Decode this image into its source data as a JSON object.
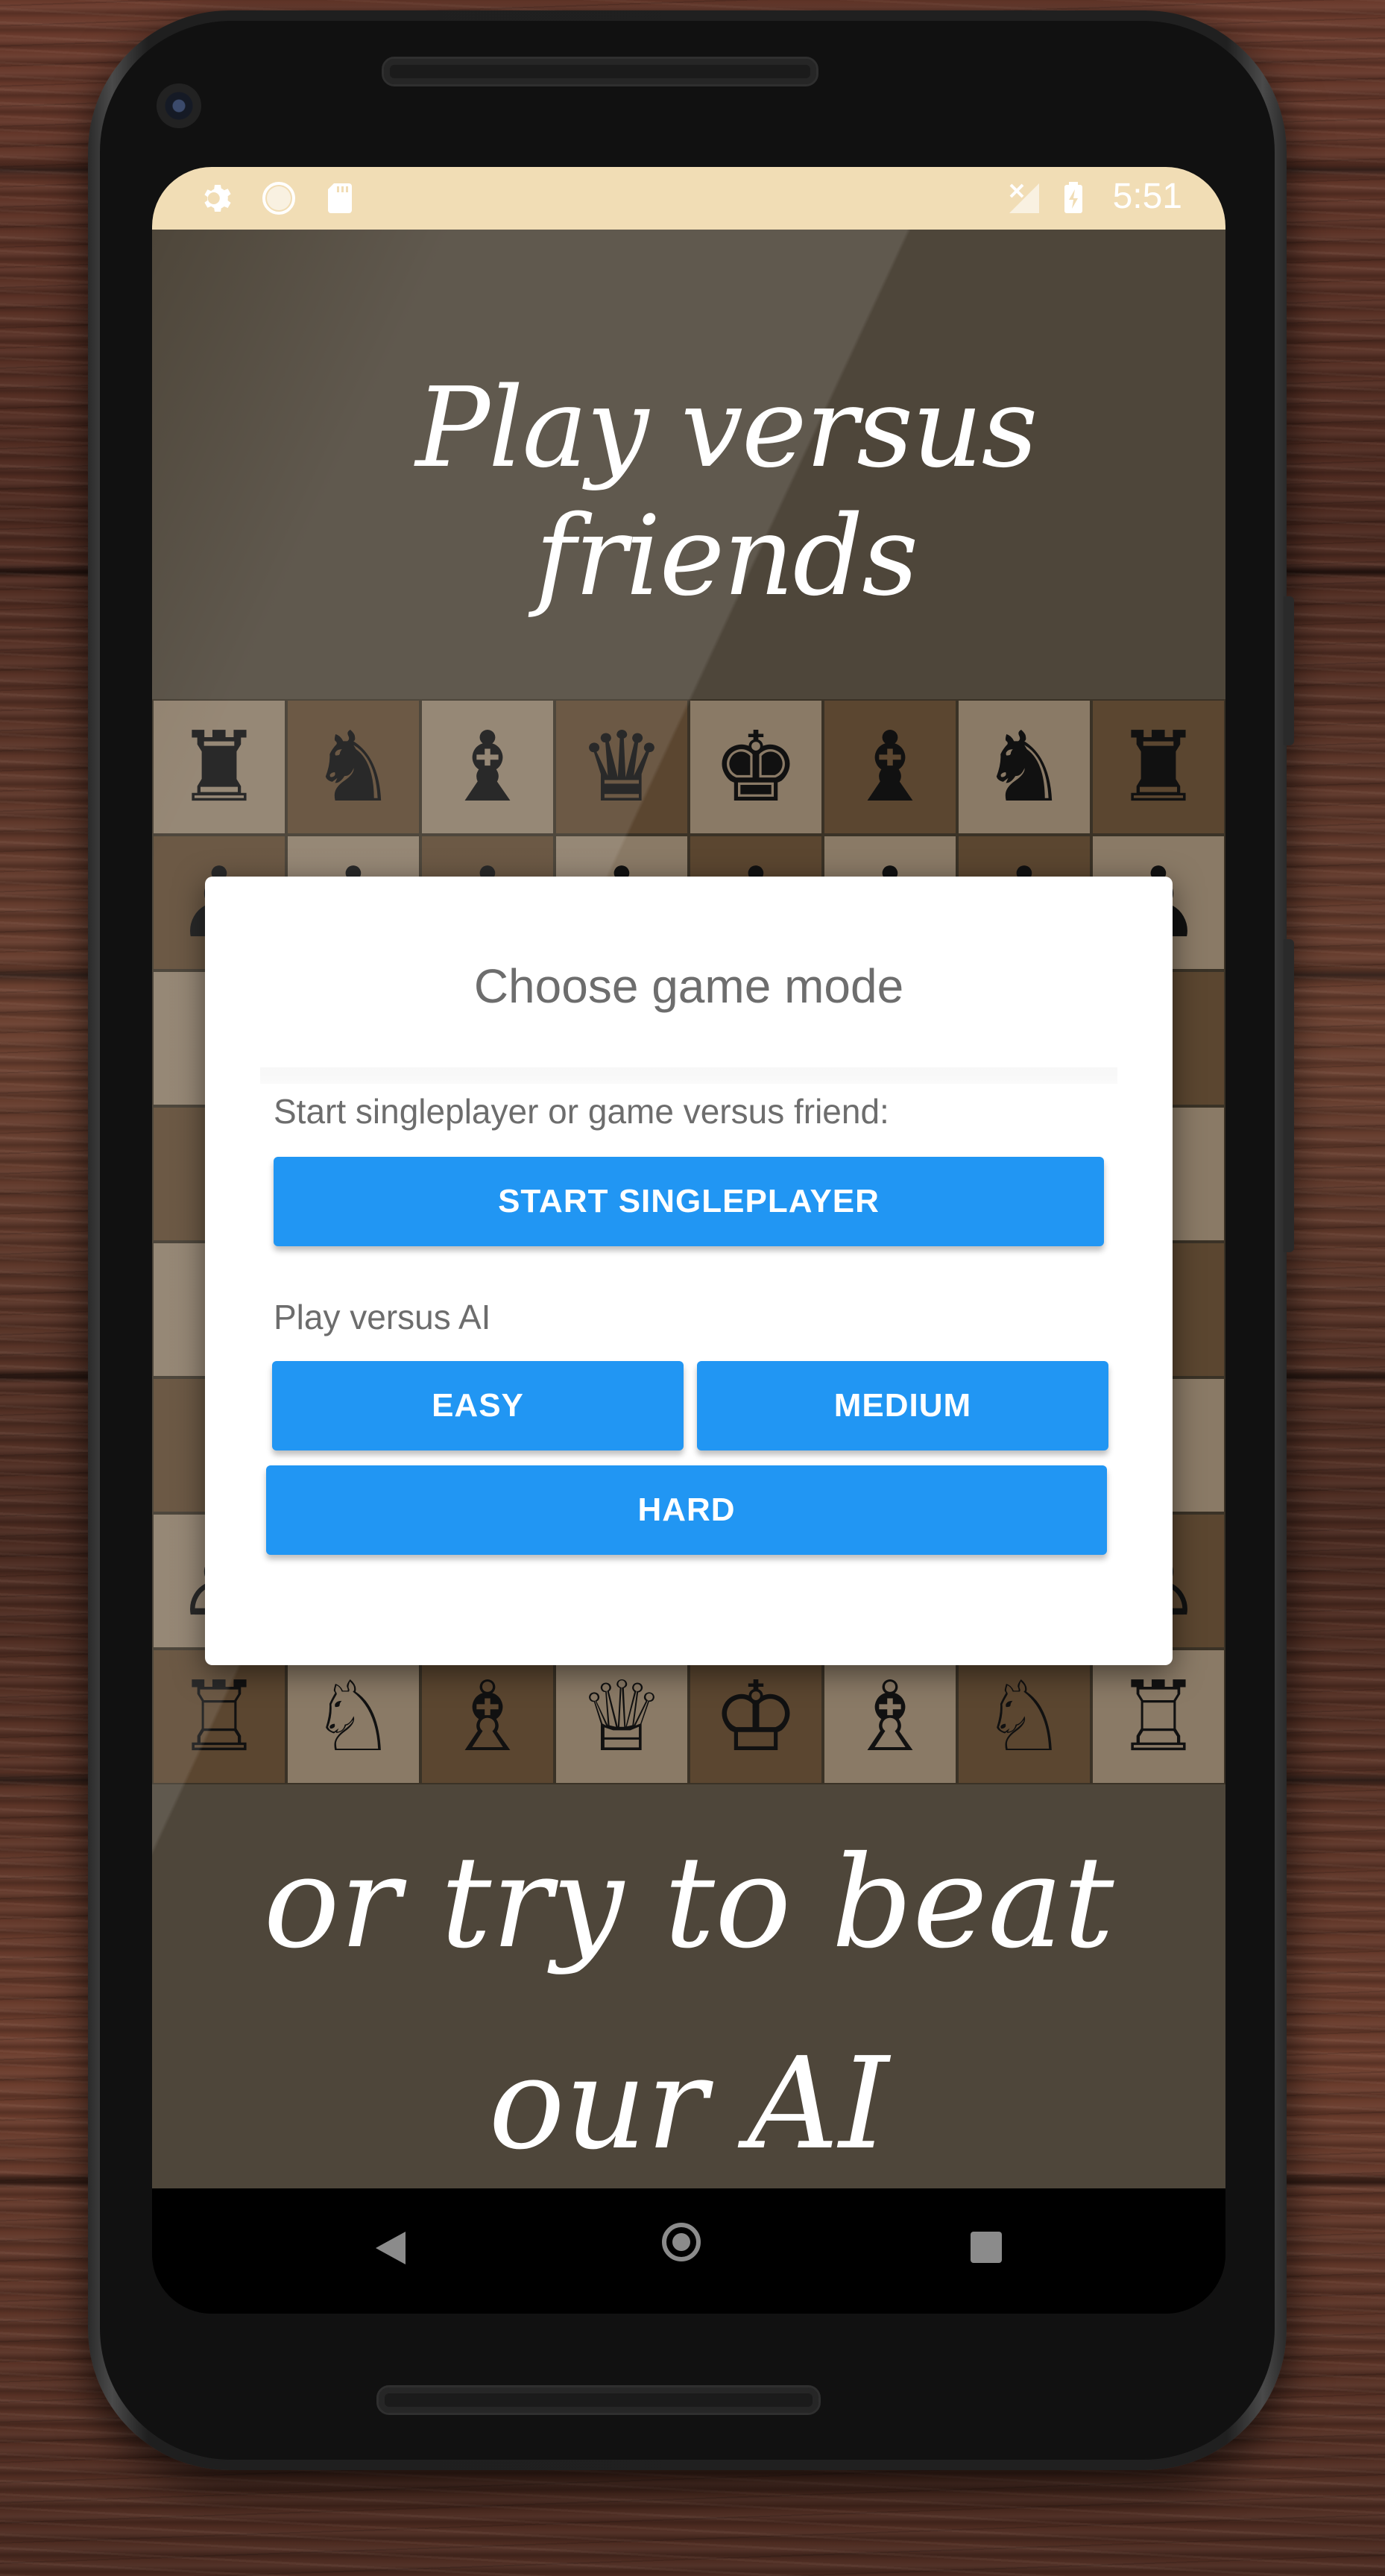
{
  "status_bar": {
    "time": "5:51",
    "icons": [
      "settings-gear-icon",
      "circle-icon",
      "sd-card-icon",
      "no-signal-icon",
      "battery-charging-icon"
    ]
  },
  "promo": {
    "headline_top": "Play versus friends",
    "headline_bottom_line1": "or try to beat",
    "headline_bottom_line2": "our AI"
  },
  "board": {
    "rows": [
      [
        "♜",
        "♞",
        "♝",
        "♛",
        "♚",
        "♝",
        "♞",
        "♜"
      ],
      [
        "♟",
        "♟",
        "♟",
        "♟",
        "♟",
        "♟",
        "♟",
        "♟"
      ],
      [
        "",
        "",
        "",
        "",
        "",
        "",
        "",
        ""
      ],
      [
        "",
        "",
        "",
        "",
        "",
        "",
        "",
        ""
      ],
      [
        "",
        "",
        "",
        "",
        "",
        "",
        "",
        ""
      ],
      [
        "",
        "",
        "",
        "",
        "",
        "",
        "",
        ""
      ],
      [
        "♙",
        "♙",
        "♙",
        "♙",
        "♙",
        "♙",
        "♙",
        "♙"
      ],
      [
        "♖",
        "♘",
        "♗",
        "♕",
        "♔",
        "♗",
        "♘",
        "♖"
      ]
    ]
  },
  "dialog": {
    "title": "Choose game mode",
    "section1_label": "Start singleplayer or game versus friend:",
    "start_singleplayer": "START SINGLEPLAYER",
    "section2_label": "Play versus AI",
    "easy": "EASY",
    "medium": "MEDIUM",
    "hard": "HARD"
  },
  "nav_bar": {
    "icons": [
      "back-icon",
      "home-icon",
      "recents-icon"
    ]
  },
  "colors": {
    "status_bar": "#f1ddb5",
    "button": "#2196f3",
    "background": "#4e463a"
  }
}
